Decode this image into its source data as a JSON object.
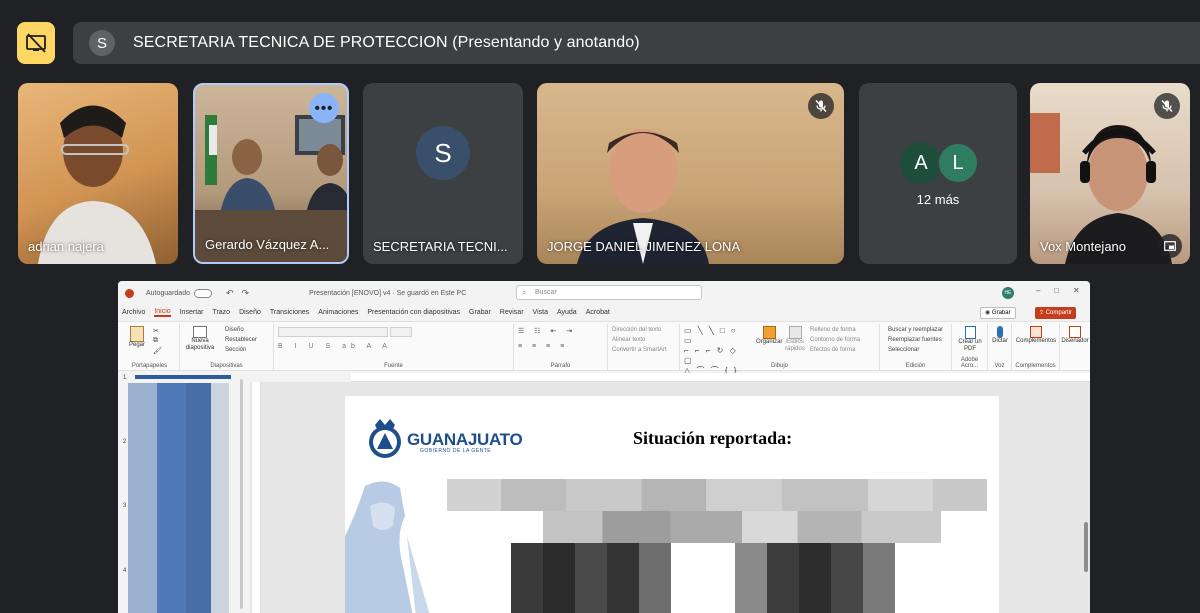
{
  "meeting": {
    "presenting_avatar": "S",
    "presenting_title": "SECRETARIA TECNICA DE PROTECCION (Presentando y anotando)"
  },
  "participants": [
    {
      "name": "adrian najera",
      "muted": false
    },
    {
      "name": "Gerardo Vázquez A...",
      "muted": false
    },
    {
      "name": "SECRETARIA TECNI...",
      "avatar": "S",
      "muted": false
    },
    {
      "name": "JORGE DANIEL JIMENEZ LONA",
      "muted": true
    },
    {
      "name": "Vox Montejano",
      "muted": true
    }
  ],
  "overflow_tile": {
    "avatars": [
      "A",
      "L"
    ],
    "label": "12 más"
  },
  "ppt": {
    "autosave": "Autoguardado",
    "file_title": "Presentación [ENOVO] v4 · Se guardó en Este PC",
    "search_placeholder": "Buscar",
    "user_initials": "HE",
    "record_label": "Grabar",
    "share_label": "Compartir",
    "tabs": [
      "Archivo",
      "Inicio",
      "Insertar",
      "Trazo",
      "Diseño",
      "Transiciones",
      "Animaciones",
      "Presentación con diapositivas",
      "Grabar",
      "Revisar",
      "Vista",
      "Ayuda",
      "Acrobat"
    ],
    "active_tab": "Inicio",
    "ribbon": {
      "paste": "Pegar",
      "clipboard_group": "Portapapeles",
      "new_slide": "Nueva diapositiva",
      "layout": "Diseño",
      "reset": "Restablecer",
      "section": "Sección",
      "slides_group": "Diapositivas",
      "font_group": "Fuente",
      "text_dir": "Dirección del texto",
      "align_text": "Alinear texto",
      "smartart": "Convertir a SmartArt",
      "paragraph_group": "Párrafo",
      "organize": "Organizar",
      "quick_styles": "Estilos rápidos",
      "shape_fill": "Relleno de forma",
      "shape_outline": "Contorno de forma",
      "shape_effects": "Efectos de forma",
      "drawing_group": "Dibujo",
      "find_replace": "Buscar y reemplazar",
      "replace_fonts": "Reemplazar fuentes",
      "select": "Seleccionar",
      "editing_group": "Edición",
      "create_pdf": "Crear un PDF",
      "adobe_group": "Adobe Acro...",
      "dictate": "Dictar",
      "voice_group": "Voz",
      "addins": "Complementos",
      "addins_group": "Complementos",
      "designer": "Diseñador"
    },
    "slide_numbers": [
      "1",
      "2",
      "3",
      "4"
    ],
    "slide": {
      "logo_text": "GUANAJUATO",
      "logo_sub": "GOBIERNO DE LA GENTE",
      "title": "Situación reportada:"
    }
  },
  "colors": {
    "present_button": "#fdd663",
    "bar": "#3c4043",
    "accent": "#8ab4f8",
    "ppt_accent": "#c43e1c",
    "logo_blue": "#1f4e8c"
  }
}
